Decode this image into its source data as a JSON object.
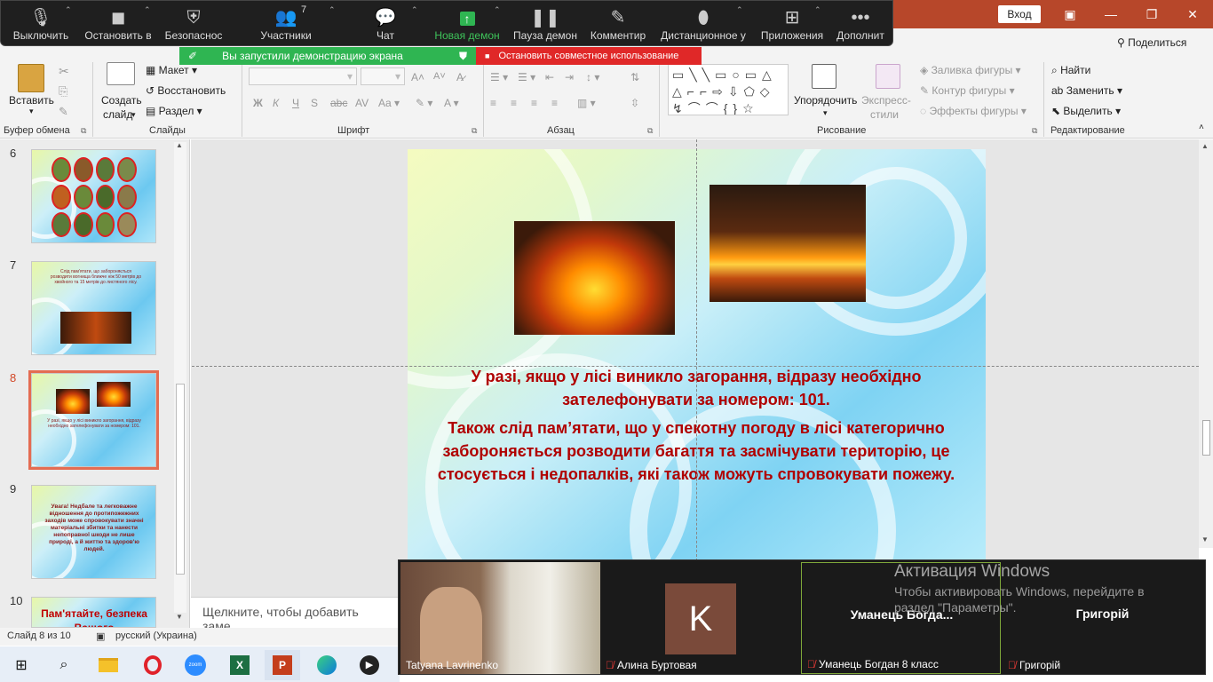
{
  "zoom_toolbar": {
    "mute": "Выключить",
    "stop_video": "Остановить в",
    "security": "Безопаснос",
    "participants": "Участники",
    "participants_count": "7",
    "chat": "Чат",
    "new_share": "Новая демон",
    "pause_share": "Пауза демон",
    "annotate": "Комментир",
    "remote": "Дистанционное у",
    "apps": "Приложения",
    "more": "Дополнит"
  },
  "window": {
    "login": "Вход",
    "share": "Поделиться"
  },
  "share_banner": {
    "started": "Вы запустили демонстрацию экрана",
    "stop": "Остановить совместное использование"
  },
  "ribbon": {
    "groups": {
      "clipboard": "Буфер обмена",
      "slides": "Слайды",
      "font": "Шрифт",
      "paragraph": "Абзац",
      "drawing": "Рисование",
      "editing": "Редактирование"
    },
    "paste": "Вставить",
    "new_slide_1": "Создать",
    "new_slide_2": "слайд",
    "layout": "Макет",
    "reset": "Восстановить",
    "section": "Раздел",
    "arrange": "Упорядочить",
    "quick_styles_1": "Экспресс-",
    "quick_styles_2": "стили",
    "shape_fill": "Заливка фигуры",
    "shape_outline": "Контур фигуры",
    "shape_effects": "Эффекты фигуры",
    "find": "Найти",
    "replace": "Заменить",
    "select": "Выделить",
    "bold": "Ж",
    "italic": "К",
    "underline": "Ч"
  },
  "thumbnails": [
    {
      "num": "6"
    },
    {
      "num": "7",
      "text": "Слід пам'ятати, що забороняється розводити вогнища ближче ніж 50 метрів до хвойного та 15 метрів до листяного лісу."
    },
    {
      "num": "8",
      "selected": true,
      "text": "У разі, якщо у лісі виникло загорання, відразу необхідно зателефонувати за номером: 101."
    },
    {
      "num": "9",
      "text": "Увага! Недбале та легковажне відношення до протипожежних заходів може спровокувати значні матеріальні збитки та нанести непоправної шкоди не лише природі, а й життю та здоров'ю людей."
    },
    {
      "num": "10",
      "text": "Пам'ятайте, безпека Вашого"
    }
  ],
  "slide": {
    "line1": "У разі, якщо у лісі виникло загорання, відразу необхідно зателефонувати за номером: 101.",
    "line2": "Також слід пам’ятати, що у спекотну погоду в лісі категорично забороняється розводити багаття та засмічувати територію, це стосується і недопалків, які також можуть спровокувати пожежу."
  },
  "notes_placeholder": "Щелкните, чтобы добавить заме",
  "status": {
    "slide_of": "Слайд 8 из 10",
    "language": "русский (Украина)"
  },
  "participants": [
    {
      "name": "Tatyana Lavrinenko",
      "muted": false
    },
    {
      "name": "Алина Буртовая",
      "muted": true,
      "initial": "K"
    },
    {
      "name": "Уманець Богдан 8 класс",
      "muted": true,
      "short": "Уманець  Богда..."
    },
    {
      "name": "Григорій",
      "muted": true,
      "short": "Григорій"
    }
  ],
  "activation": {
    "title": "Активация Windows",
    "line1": "Чтобы активировать Windows, перейдите в",
    "line2": "раздел \"Параметры\"."
  },
  "colors": {
    "powerpoint": "#b7472a",
    "zoom_green": "#2fb552",
    "zoom_red": "#e02828",
    "slide_text": "#b00000",
    "selection": "#e46c52"
  }
}
